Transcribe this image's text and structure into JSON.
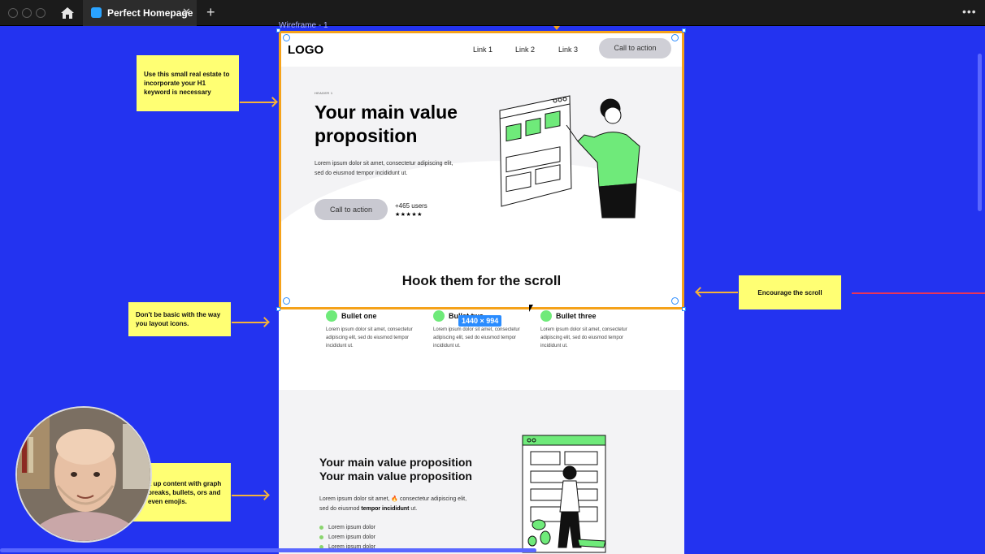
{
  "browser": {
    "tab_title": "Perfect Homepage",
    "tab_close": "✕",
    "new_tab": "+",
    "more": "•••"
  },
  "canvas": {
    "frame_label": "Wireframe - 1",
    "dimensions": "1440 × 994"
  },
  "wireframe": {
    "logo": "LOGO",
    "links": [
      "Link 1",
      "Link 2",
      "Link 3"
    ],
    "nav_cta": "Call to action",
    "eyebrow": "HEADER 1",
    "h1": "Your main value proposition",
    "lead": "Lorem ipsum dolor sit amet, consectetur adipiscing elit, sed do eiusmod tempor incididunt ut.",
    "hero_cta": "Call to action",
    "users": "+465 users",
    "stars": "★★★★★",
    "hook": "Hook them for the scroll",
    "bullets": [
      {
        "title": "Bullet one",
        "text": "Lorem ipsum dolor sit amet, consectetur adipiscing elit, sed do eiusmod tempor incididunt ut."
      },
      {
        "title": "Bullet two",
        "text": "Lorem ipsum dolor sit amet, consectetur adipiscing elit, sed do eiusmod tempor incididunt ut."
      },
      {
        "title": "Bullet three",
        "text": "Lorem ipsum dolor sit amet, consectetur adipiscing elit, sed do eiusmod tempor incididunt ut."
      }
    ],
    "section2": {
      "h2_line1": "Your main value proposition",
      "h2_line2": "Your main value proposition",
      "p_part1": "Lorem ipsum dolor sit amet, 🔥 consectetur adipiscing elit, sed do eiusmod ",
      "p_bold": "tempor incididunt",
      "p_part2": " ut.",
      "list": [
        "Lorem ipsum dolor",
        "Lorem ipsum dolor",
        "Lorem ipsum dolor"
      ]
    }
  },
  "notes": {
    "h1_note": "Use this small real estate to incorporate your H1 keyword is necessary",
    "icons_note": "Don't be basic with the way you layout icons.",
    "scroll_note": "Encourage the scroll",
    "content_note": "k up content with graph breaks, bullets, ors and even emojis."
  },
  "colors": {
    "canvas_bg": "#2333f0",
    "selection": "#f5a21a",
    "sticky_note": "#ffff73",
    "accent_green": "#6fea7a",
    "dims_badge": "#2a8cff"
  }
}
